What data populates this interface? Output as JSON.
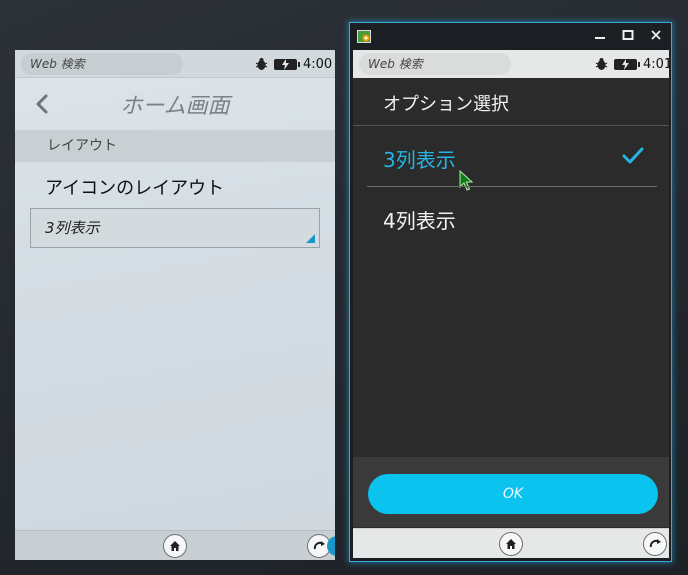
{
  "left_phone": {
    "status": {
      "search_placeholder": "Web 検索",
      "time": "4:00"
    },
    "header": {
      "title": "ホーム画面"
    },
    "section": {
      "label": "レイアウト"
    },
    "setting": {
      "label": "アイコンのレイアウト",
      "value": "3列表示"
    },
    "icons": [
      "chevron-left-icon",
      "bug-icon",
      "battery-charging-icon",
      "home-icon",
      "rotate-icon"
    ]
  },
  "emulator_window": {
    "icons": [
      "app-icon",
      "minimize-icon",
      "maximize-icon",
      "close-icon"
    ],
    "status": {
      "search_placeholder": "Web 検索",
      "time": "4:01"
    },
    "dialog": {
      "title": "オプション選択",
      "options": [
        {
          "label": "3列表示",
          "selected": true
        },
        {
          "label": "4列表示",
          "selected": false
        }
      ],
      "ok_label": "OK"
    },
    "colors": {
      "accent": "#25b4e3",
      "ok_button": "#0ac3ee",
      "window_border": "#3ea8d8"
    }
  }
}
